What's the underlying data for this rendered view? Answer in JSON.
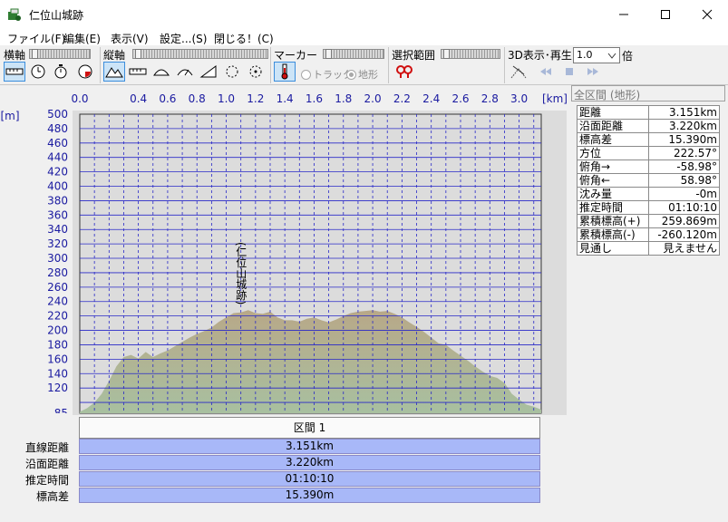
{
  "window": {
    "title": "仁位山城跡",
    "minimize": "—",
    "maximize": "☐",
    "close": "✕"
  },
  "menu": [
    "ファイル(F)",
    "編集(E)",
    "表示(V)",
    "設定...(S)",
    "閉じる！(C)"
  ],
  "toolbar": {
    "horizontal_axis_label": "横軸",
    "vertical_axis_label": "縦軸",
    "marker_label": "マーカー",
    "selection_label": "選択範囲",
    "playback_label": "3D表示･再生",
    "radio_track": "トラック",
    "radio_terrain": "地形",
    "radio_selected": "地形",
    "speed_value": "1.0",
    "speed_unit": "倍"
  },
  "chart_data": {
    "type": "area",
    "xlabel": "[km]",
    "ylabel": "[m]",
    "x_ticks": [
      "0.0",
      "0.4",
      "0.6",
      "0.8",
      "1.0",
      "1.2",
      "1.4",
      "1.6",
      "1.8",
      "2.0",
      "2.2",
      "2.4",
      "2.6",
      "2.8",
      "3.0"
    ],
    "y_ticks": [
      "500",
      "480",
      "460",
      "440",
      "420",
      "400",
      "380",
      "360",
      "340",
      "320",
      "300",
      "280",
      "260",
      "240",
      "220",
      "200",
      "180",
      "160",
      "140",
      "120",
      "85"
    ],
    "xlim": [
      0,
      3.151
    ],
    "ylim": [
      85,
      500
    ],
    "annotation": "(仁位山城跡)",
    "annotation_x": 1.1,
    "series": [
      {
        "x": [
          0.0,
          0.05,
          0.1,
          0.15,
          0.2,
          0.25,
          0.3,
          0.35,
          0.4,
          0.45,
          0.5,
          0.55,
          0.6,
          0.65,
          0.7,
          0.75,
          0.8,
          0.85,
          0.9,
          0.95,
          1.0,
          1.05,
          1.1,
          1.15,
          1.2,
          1.25,
          1.3,
          1.35,
          1.4,
          1.45,
          1.5,
          1.55,
          1.6,
          1.65,
          1.7,
          1.75,
          1.8,
          1.85,
          1.9,
          1.95,
          2.0,
          2.05,
          2.1,
          2.15,
          2.2,
          2.25,
          2.3,
          2.35,
          2.4,
          2.45,
          2.5,
          2.55,
          2.6,
          2.65,
          2.7,
          2.75,
          2.8,
          2.85,
          2.9,
          2.95,
          3.0,
          3.05,
          3.1,
          3.151
        ],
        "y": [
          87,
          92,
          100,
          112,
          130,
          150,
          163,
          166,
          161,
          170,
          163,
          168,
          172,
          178,
          184,
          190,
          195,
          199,
          204,
          212,
          218,
          224,
          225,
          228,
          224,
          223,
          226,
          218,
          214,
          214,
          212,
          216,
          218,
          214,
          211,
          215,
          220,
          224,
          226,
          227,
          228,
          226,
          227,
          223,
          218,
          211,
          205,
          198,
          190,
          182,
          180,
          172,
          165,
          158,
          150,
          143,
          137,
          134,
          127,
          112,
          104,
          97,
          94,
          90
        ]
      }
    ],
    "grid": true
  },
  "panel": {
    "header": "全区間 (地形)",
    "rows": [
      {
        "label": "距離",
        "value": "3.151km"
      },
      {
        "label": "沿面距離",
        "value": "3.220km"
      },
      {
        "label": "標高差",
        "value": "15.390m"
      },
      {
        "label": "方位",
        "value": "222.57°"
      },
      {
        "label": "俯角→",
        "value": "-58.98°"
      },
      {
        "label": "俯角←",
        "value": "58.98°"
      },
      {
        "label": "沈み量",
        "value": "-0m"
      },
      {
        "label": "推定時間",
        "value": "01:10:10"
      },
      {
        "label": "累積標高(+)",
        "value": "259.869m"
      },
      {
        "label": "累積標高(-)",
        "value": "-260.120m"
      },
      {
        "label": "見通し",
        "value": "見えません"
      }
    ]
  },
  "section": {
    "header": "区間 1",
    "rows": [
      {
        "label": "直線距離",
        "value": "3.151km"
      },
      {
        "label": "沿面距離",
        "value": "3.220km"
      },
      {
        "label": "推定時間",
        "value": "01:10:10"
      },
      {
        "label": "標高差",
        "value": "15.390m"
      }
    ]
  },
  "colors": {
    "plot_background": "#dcdcdc",
    "grid": "#2828c8",
    "area_top": "#b8a888",
    "area_bottom": "#a8c0a0",
    "axis_text": "#1a1aa0",
    "section_row_bg": "#a8b8f8"
  }
}
